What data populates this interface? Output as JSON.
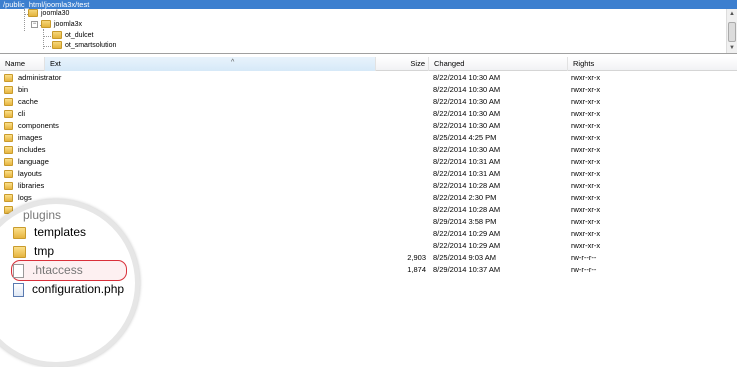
{
  "path": "/public_html/joomla3x/test",
  "tree": {
    "items": [
      "joomla30",
      "joomla3x",
      "ot_dulcet",
      "ot_smartsolution"
    ]
  },
  "columns": {
    "name": "Name",
    "ext": "Ext",
    "size": "Size",
    "changed": "Changed",
    "rights": "Rights"
  },
  "rows": [
    {
      "name": "administrator",
      "size": "",
      "changed": "8/22/2014 10:30 AM",
      "rights": "rwxr-xr-x",
      "type": "folder"
    },
    {
      "name": "bin",
      "size": "",
      "changed": "8/22/2014 10:30 AM",
      "rights": "rwxr-xr-x",
      "type": "folder"
    },
    {
      "name": "cache",
      "size": "",
      "changed": "8/22/2014 10:30 AM",
      "rights": "rwxr-xr-x",
      "type": "folder"
    },
    {
      "name": "cli",
      "size": "",
      "changed": "8/22/2014 10:30 AM",
      "rights": "rwxr-xr-x",
      "type": "folder"
    },
    {
      "name": "components",
      "size": "",
      "changed": "8/22/2014 10:30 AM",
      "rights": "rwxr-xr-x",
      "type": "folder"
    },
    {
      "name": "images",
      "size": "",
      "changed": "8/25/2014 4:25 PM",
      "rights": "rwxr-xr-x",
      "type": "folder"
    },
    {
      "name": "includes",
      "size": "",
      "changed": "8/22/2014 10:30 AM",
      "rights": "rwxr-xr-x",
      "type": "folder"
    },
    {
      "name": "language",
      "size": "",
      "changed": "8/22/2014 10:31 AM",
      "rights": "rwxr-xr-x",
      "type": "folder"
    },
    {
      "name": "layouts",
      "size": "",
      "changed": "8/22/2014 10:31 AM",
      "rights": "rwxr-xr-x",
      "type": "folder"
    },
    {
      "name": "libraries",
      "size": "",
      "changed": "8/22/2014 10:28 AM",
      "rights": "rwxr-xr-x",
      "type": "folder"
    },
    {
      "name": "logs",
      "size": "",
      "changed": "8/22/2014 2:30 PM",
      "rights": "rwxr-xr-x",
      "type": "folder"
    },
    {
      "name": "media",
      "size": "",
      "changed": "8/22/2014 10:28 AM",
      "rights": "rwxr-xr-x",
      "type": "folder"
    },
    {
      "name": "",
      "size": "",
      "changed": "8/29/2014 3:58 PM",
      "rights": "rwxr-xr-x",
      "type": "folder"
    },
    {
      "name": "",
      "size": "",
      "changed": "8/22/2014 10:29 AM",
      "rights": "rwxr-xr-x",
      "type": "folder"
    },
    {
      "name": "",
      "size": "",
      "changed": "8/22/2014 10:29 AM",
      "rights": "rwxr-xr-x",
      "type": "folder"
    },
    {
      "name": "",
      "size": "2,903",
      "changed": "8/25/2014 9:03 AM",
      "rights": "rw-r--r--",
      "type": "file"
    },
    {
      "name": "",
      "size": "1,874",
      "changed": "8/29/2014 10:37 AM",
      "rights": "rw-r--r--",
      "type": "file"
    }
  ],
  "magnifier": {
    "partial": "plugins",
    "items": [
      "templates",
      "tmp",
      ".htaccess",
      "configuration.php"
    ]
  },
  "colors": {
    "pathbar": "#3c7fcf",
    "highlight": "#d9303a"
  }
}
